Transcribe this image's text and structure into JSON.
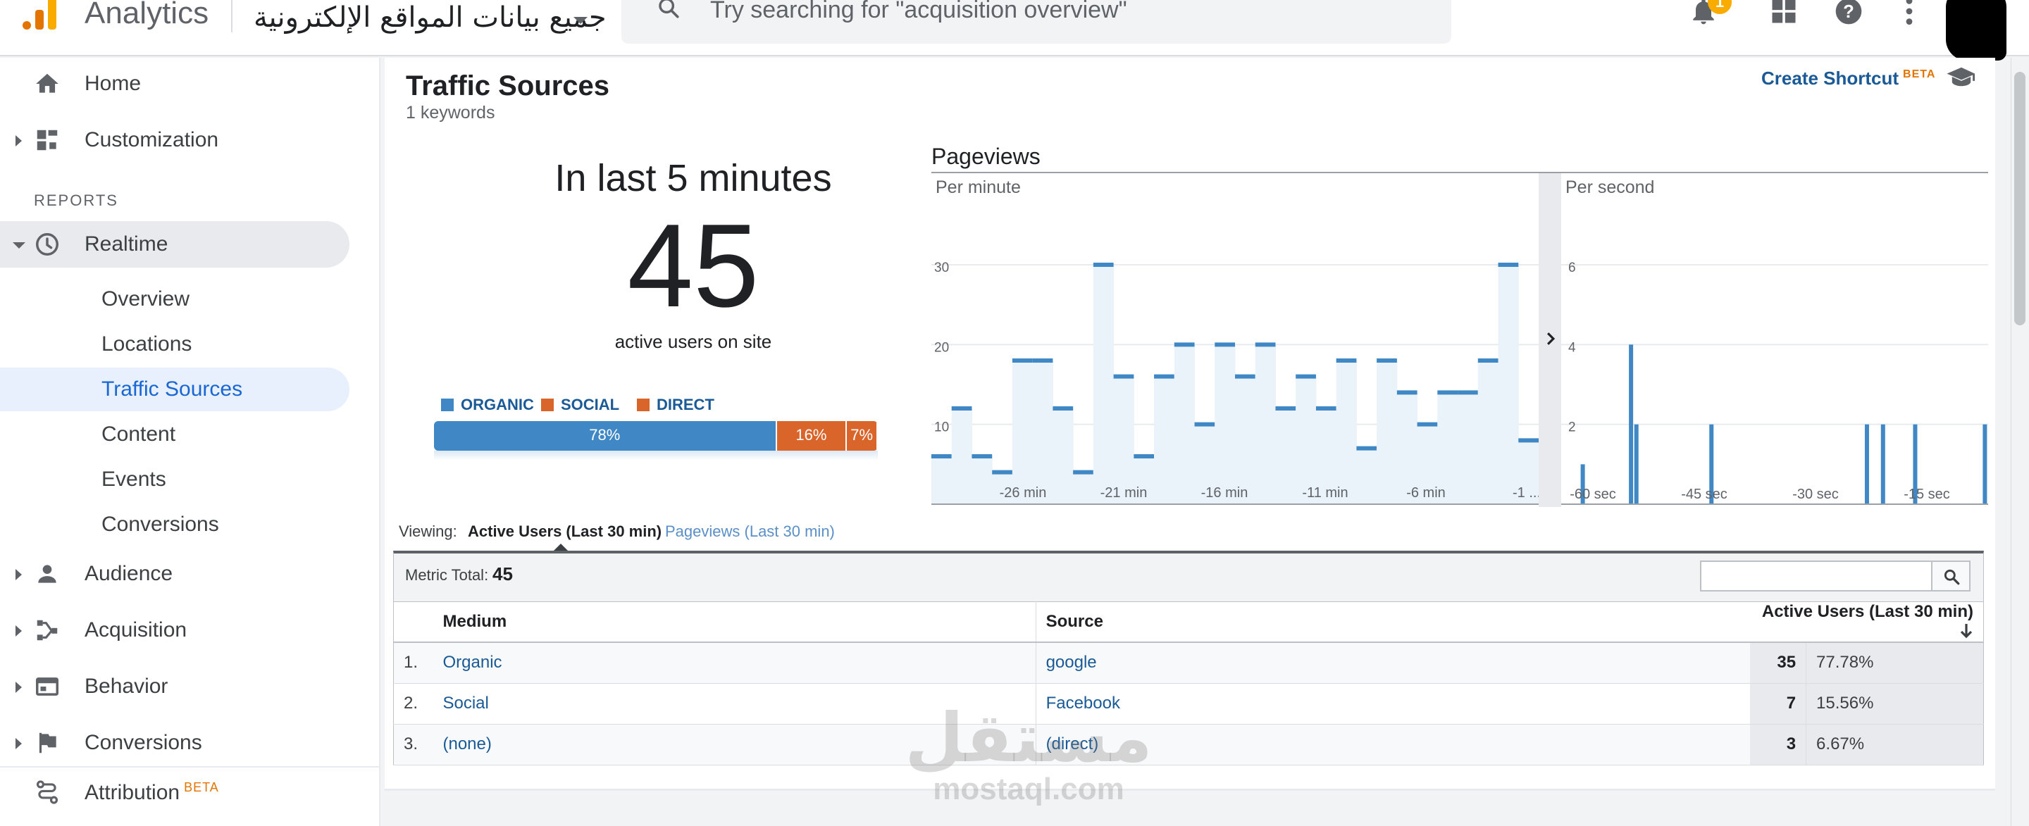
{
  "app": {
    "title": "Analytics",
    "account": "جميع بيانات المواقع الإلكترونية",
    "search_placeholder": "Try searching for \"acquisition overview\"",
    "notification_count": "1"
  },
  "sidebar": {
    "top_items": [
      {
        "label": "Home",
        "icon": "home-icon"
      },
      {
        "label": "Customization",
        "icon": "dashboard-icon"
      }
    ],
    "reports_label": "REPORTS",
    "realtime": {
      "label": "Realtime",
      "icon": "clock-icon",
      "children": [
        "Overview",
        "Locations",
        "Traffic Sources",
        "Content",
        "Events",
        "Conversions"
      ],
      "selected": "Traffic Sources"
    },
    "report_items": [
      {
        "label": "Audience",
        "icon": "person-icon"
      },
      {
        "label": "Acquisition",
        "icon": "acquisition-icon"
      },
      {
        "label": "Behavior",
        "icon": "behavior-icon"
      },
      {
        "label": "Conversions",
        "icon": "flag-icon"
      }
    ],
    "attribution": {
      "label": "Attribution",
      "badge": "BETA"
    }
  },
  "header": {
    "title": "Traffic Sources",
    "subtitle": "1 keywords",
    "create_shortcut": "Create Shortcut",
    "beta": "BETA"
  },
  "kpi": {
    "heading": "In last 5 minutes",
    "value": "45",
    "caption": "active users on site"
  },
  "breakdown": {
    "legend": [
      {
        "label": "ORGANIC",
        "color": "#3f88c5"
      },
      {
        "label": "SOCIAL",
        "color": "#d9652b"
      },
      {
        "label": "DIRECT",
        "color": "#d9652b"
      }
    ],
    "segments": [
      {
        "label": "78%",
        "value": 78,
        "color": "#3f88c5"
      },
      {
        "label": "16%",
        "value": 16,
        "color": "#d9652b"
      },
      {
        "label": "7%",
        "value": 7,
        "color": "#d9652b"
      }
    ]
  },
  "pageviews": {
    "title": "Pageviews",
    "per_minute_label": "Per minute",
    "per_second_label": "Per second"
  },
  "chart_data": [
    {
      "type": "area",
      "name": "Per minute",
      "y_ticks": [
        10,
        20,
        30
      ],
      "ylim": [
        0,
        30
      ],
      "x_ticks": [
        "-26 min",
        "-21 min",
        "-16 min",
        "-11 min",
        "-6 min",
        "-1 ..."
      ],
      "values": [
        6,
        12,
        6,
        4,
        18,
        18,
        12,
        4,
        30,
        16,
        6,
        16,
        20,
        10,
        20,
        16,
        20,
        12,
        16,
        12,
        18,
        7,
        18,
        14,
        10,
        14,
        14,
        18,
        30,
        8
      ],
      "color": "#3f88c5"
    },
    {
      "type": "bar",
      "name": "Per second",
      "y_ticks": [
        2,
        4,
        6
      ],
      "ylim": [
        0,
        6
      ],
      "x_ticks": [
        "-60 sec",
        "-45 sec",
        "-30 sec",
        "-15 sec"
      ],
      "values": [
        0,
        1,
        0,
        0,
        0,
        0,
        0,
        0,
        0,
        0,
        4,
        2,
        0,
        0,
        0,
        0,
        0,
        0,
        0,
        0,
        0,
        0,
        0,
        0,
        0,
        2,
        0,
        0,
        0,
        0,
        0,
        0,
        0,
        0,
        0,
        0,
        0,
        0,
        0,
        0,
        0,
        0,
        0,
        0,
        0,
        0,
        0,
        0,
        0,
        0,
        0,
        0,
        0,
        0,
        2,
        0,
        0,
        2,
        0,
        0,
        0,
        0,
        0,
        2,
        0,
        0,
        0,
        0,
        0,
        0,
        0,
        0,
        0,
        0,
        0,
        0,
        2
      ],
      "color": "#3f88c5"
    }
  ],
  "viewing": {
    "label": "Viewing:",
    "tabs": [
      "Active Users (Last 30 min)",
      "Pageviews (Last 30 min)"
    ]
  },
  "metric": {
    "label": "Metric Total:",
    "value": "45"
  },
  "table": {
    "columns": [
      "Medium",
      "Source",
      "Active Users (Last 30 min)"
    ],
    "rows": [
      {
        "index": "1.",
        "medium": "Organic",
        "source": "google",
        "users": "35",
        "pct": "77.78%"
      },
      {
        "index": "2.",
        "medium": "Social",
        "source": "Facebook",
        "users": "7",
        "pct": "15.56%"
      },
      {
        "index": "3.",
        "medium": "(none)",
        "source": "(direct)",
        "users": "3",
        "pct": "6.67%"
      }
    ]
  },
  "watermark": {
    "arabic": "مستقل",
    "latin": "mostaql.com"
  }
}
